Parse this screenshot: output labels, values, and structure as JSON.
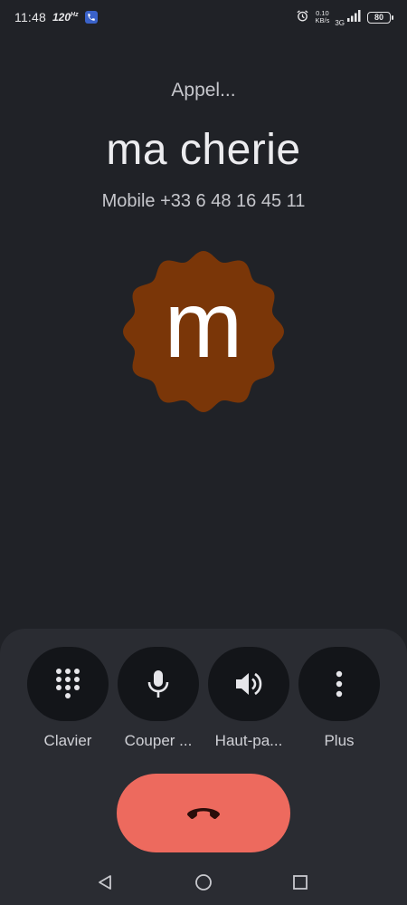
{
  "status_bar": {
    "time": "11:48",
    "refresh_rate": "120",
    "net_speed_value": "0.10",
    "net_speed_unit": "KB/s",
    "network": "3G",
    "battery": "80"
  },
  "call": {
    "status": "Appel...",
    "name": "ma cherie",
    "number": "Mobile +33 6 48 16 45 11",
    "avatar_letter": "m",
    "avatar_color": "#7a3608"
  },
  "controls": [
    {
      "label": "Clavier",
      "icon": "dialpad-icon"
    },
    {
      "label": "Couper ...",
      "icon": "microphone-icon"
    },
    {
      "label": "Haut-pa...",
      "icon": "speaker-icon"
    },
    {
      "label": "Plus",
      "icon": "more-vert-icon"
    }
  ],
  "end_call": {
    "icon": "end-call-icon",
    "color": "#ed6a5e"
  },
  "nav": {
    "back": "back-icon",
    "home": "home-icon",
    "recents": "recents-icon"
  }
}
